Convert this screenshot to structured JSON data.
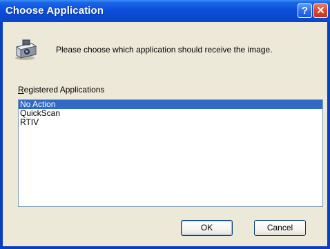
{
  "window": {
    "title": "Choose Application",
    "help_label": "?",
    "close_label": "✕"
  },
  "prompt": "Please choose which application should receive the image.",
  "list": {
    "label_first": "R",
    "label_rest": "egistered Applications",
    "items": [
      {
        "label": "No Action",
        "selected": true
      },
      {
        "label": "QuickScan",
        "selected": false
      },
      {
        "label": "RTIV",
        "selected": false
      }
    ]
  },
  "buttons": {
    "ok_label": "OK",
    "cancel_label": "Cancel"
  },
  "icons": {
    "scanner": "scanner-camera-icon",
    "help": "help-icon",
    "close": "close-icon"
  },
  "colors": {
    "title_blue": "#0b4fd8",
    "selection": "#316ac5",
    "dialog_bg": "#ece9d8",
    "close_red": "#e0452a"
  }
}
